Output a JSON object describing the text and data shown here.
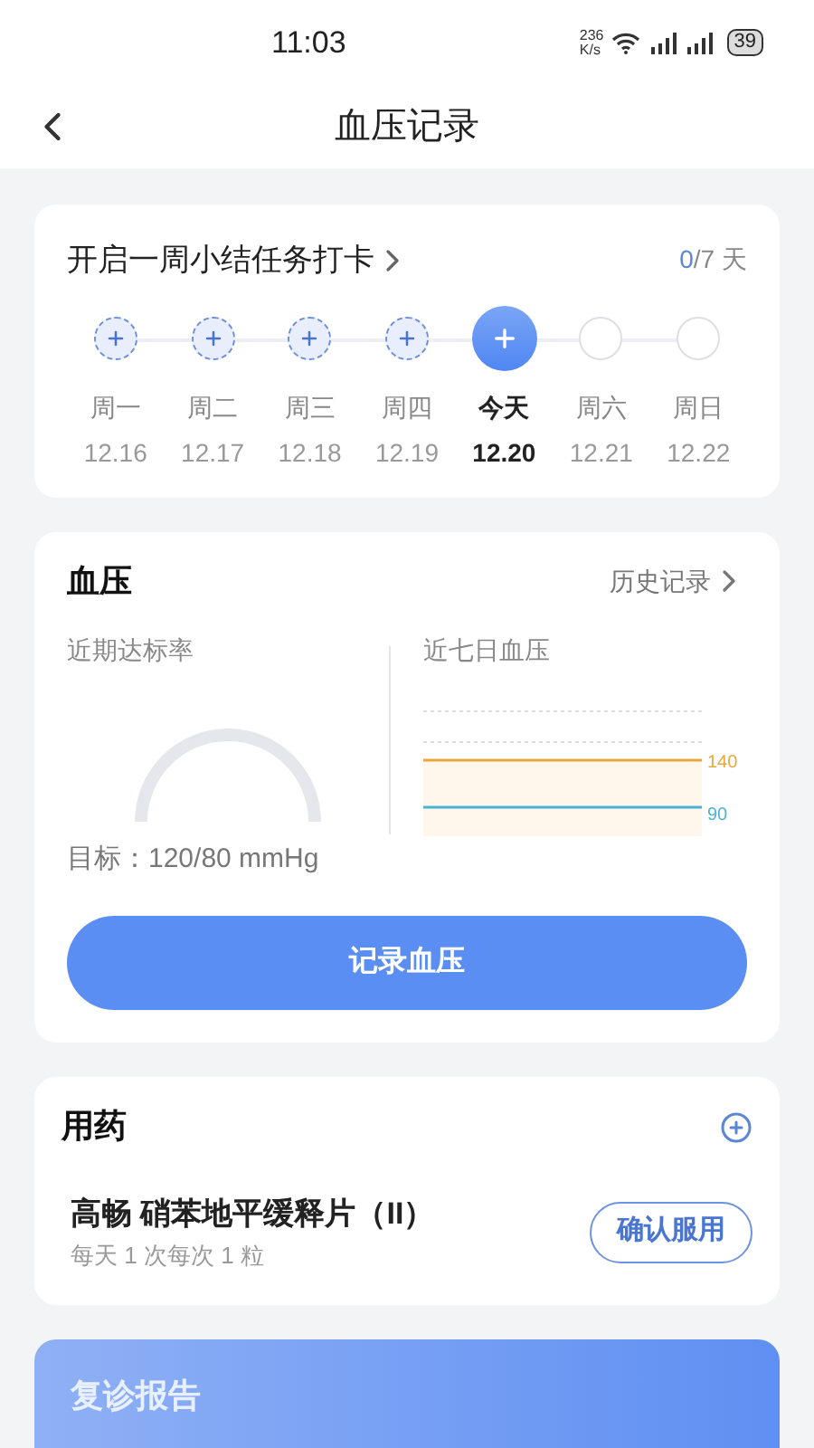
{
  "status_bar": {
    "time": "11:03",
    "speed": "236",
    "speed_unit": "K/s",
    "battery": "39"
  },
  "header": {
    "title": "血压记录"
  },
  "checkin": {
    "title": "开启一周小结任务打卡",
    "done": "0",
    "total": "/7 天",
    "days": [
      {
        "kind": "missed",
        "weekday": "周一",
        "date": "12.16"
      },
      {
        "kind": "missed",
        "weekday": "周二",
        "date": "12.17"
      },
      {
        "kind": "missed",
        "weekday": "周三",
        "date": "12.18"
      },
      {
        "kind": "missed",
        "weekday": "周四",
        "date": "12.19"
      },
      {
        "kind": "today",
        "weekday": "今天",
        "date": "12.20"
      },
      {
        "kind": "upcoming",
        "weekday": "周六",
        "date": "12.21"
      },
      {
        "kind": "upcoming",
        "weekday": "周日",
        "date": "12.22"
      }
    ]
  },
  "blood_pressure": {
    "title": "血压",
    "history_link": "历史记录",
    "rate_label": "近期达标率",
    "week_label": "近七日血压",
    "upper_line": "140",
    "lower_line": "90",
    "target": "目标：120/80 mmHg",
    "record_button": "记录血压"
  },
  "medication": {
    "title": "用药",
    "items": [
      {
        "name": "高畅 硝苯地平缓释片（II）",
        "dosage": "每天 1 次每次 1 粒",
        "confirm_button": "确认服用"
      }
    ]
  },
  "report": {
    "title": "复诊报告"
  }
}
